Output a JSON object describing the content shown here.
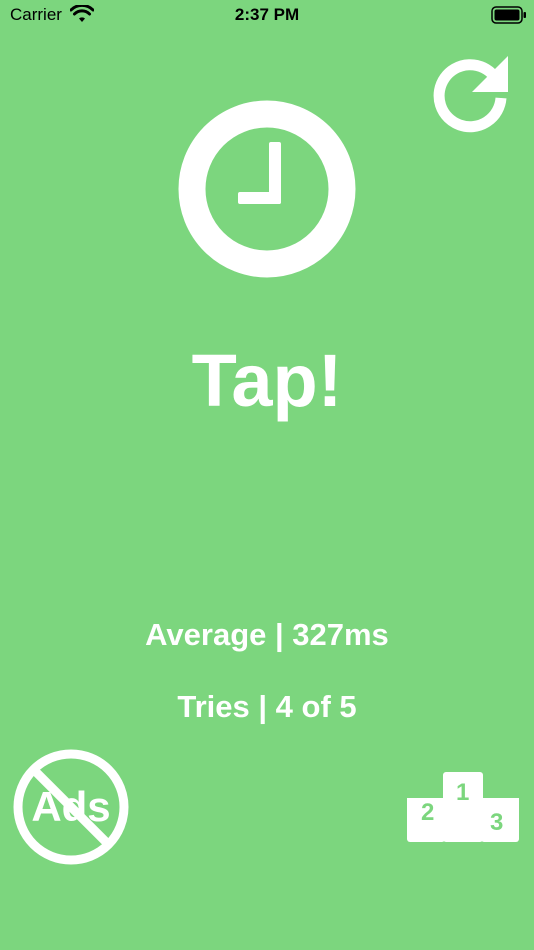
{
  "status_bar": {
    "carrier": "Carrier",
    "time": "2:37 PM"
  },
  "game": {
    "prompt": "Tap!",
    "average": "Average | 327ms",
    "tries": "Tries | 4 of 5"
  },
  "no_ads": {
    "label": "Ads"
  },
  "leaderboard": {
    "first": "1",
    "second": "2",
    "third": "3"
  },
  "colors": {
    "background": "#7cd67e",
    "foreground": "#ffffff"
  },
  "icons": {
    "restart": "restart-icon",
    "clock": "clock-icon",
    "no_ads": "no-ads-icon",
    "leaderboard": "podium-icon"
  }
}
